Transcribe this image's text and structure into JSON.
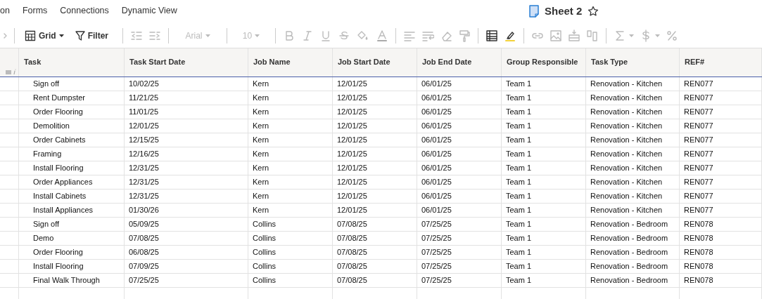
{
  "menu": [
    {
      "label": "on"
    },
    {
      "label": "Forms"
    },
    {
      "label": "Connections"
    },
    {
      "label": "Dynamic View"
    }
  ],
  "sheet": {
    "title": "Sheet 2",
    "starred": false
  },
  "toolbar": {
    "view_button": {
      "label": "Grid"
    },
    "filter_button": {
      "label": "Filter"
    },
    "font": {
      "value": "Arial",
      "disabled": true
    },
    "font_size": {
      "value": "10",
      "disabled": true
    }
  },
  "table": {
    "columns": [
      "Task",
      "Task Start Date",
      "Job Name",
      "Job Start Date",
      "Job End Date",
      "Group Responsible",
      "Task Type",
      "REF#"
    ],
    "rows": [
      [
        "Sign off",
        "10/02/25",
        "Kern",
        "12/01/25",
        "06/01/25",
        "Team 1",
        "Renovation - Kitchen",
        "REN077"
      ],
      [
        "Rent Dumpster",
        "11/21/25",
        "Kern",
        "12/01/25",
        "06/01/25",
        "Team 1",
        "Renovation - Kitchen",
        "REN077"
      ],
      [
        "Order Flooring",
        "11/01/25",
        "Kern",
        "12/01/25",
        "06/01/25",
        "Team 1",
        "Renovation - Kitchen",
        "REN077"
      ],
      [
        "Demolition",
        "12/01/25",
        "Kern",
        "12/01/25",
        "06/01/25",
        "Team 1",
        "Renovation - Kitchen",
        "REN077"
      ],
      [
        "Order Cabinets",
        "12/15/25",
        "Kern",
        "12/01/25",
        "06/01/25",
        "Team 1",
        "Renovation - Kitchen",
        "REN077"
      ],
      [
        "Framing",
        "12/16/25",
        "Kern",
        "12/01/25",
        "06/01/25",
        "Team 1",
        "Renovation - Kitchen",
        "REN077"
      ],
      [
        "Install Flooring",
        "12/31/25",
        "Kern",
        "12/01/25",
        "06/01/25",
        "Team 1",
        "Renovation - Kitchen",
        "REN077"
      ],
      [
        "Order Appliances",
        "12/31/25",
        "Kern",
        "12/01/25",
        "06/01/25",
        "Team 1",
        "Renovation - Kitchen",
        "REN077"
      ],
      [
        "Install Cabinets",
        "12/31/25",
        "Kern",
        "12/01/25",
        "06/01/25",
        "Team 1",
        "Renovation - Kitchen",
        "REN077"
      ],
      [
        "Install Appliances",
        "01/30/26",
        "Kern",
        "12/01/25",
        "06/01/25",
        "Team 1",
        "Renovation - Kitchen",
        "REN077"
      ],
      [
        "Sign off",
        "05/09/25",
        "Collins",
        "07/08/25",
        "07/25/25",
        "Team 1",
        "Renovation - Bedroom",
        "REN078"
      ],
      [
        "Demo",
        "07/08/25",
        "Collins",
        "07/08/25",
        "07/25/25",
        "Team 1",
        "Renovation - Bedroom",
        "REN078"
      ],
      [
        "Order Flooring",
        "06/08/25",
        "Collins",
        "07/08/25",
        "07/25/25",
        "Team 1",
        "Renovation - Bedroom",
        "REN078"
      ],
      [
        "Install Flooring",
        "07/09/25",
        "Collins",
        "07/08/25",
        "07/25/25",
        "Team 1",
        "Renovation - Bedroom",
        "REN078"
      ],
      [
        "Final Walk Through",
        "07/25/25",
        "Collins",
        "07/08/25",
        "07/25/25",
        "Team 1",
        "Renovation - Bedroom",
        "REN078"
      ]
    ]
  }
}
